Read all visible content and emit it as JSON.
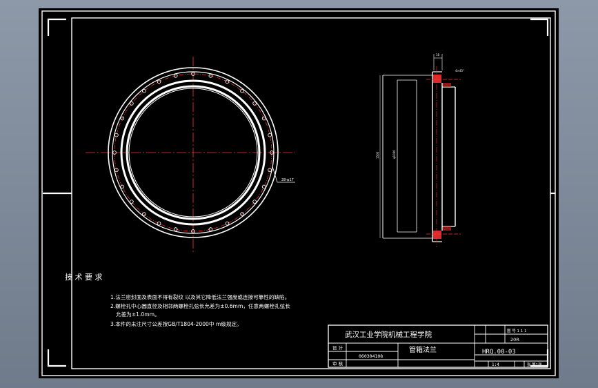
{
  "drawing": {
    "tech_req": {
      "title": "技 术 要 求",
      "items": [
        "1.法兰密封面及表面不得有裂纹 以及其它降低法兰强度或连接可靠性的缺陷。",
        "2.螺栓孔中心圆直径及相邻两螺栓孔弦长允差为±0.6mm，任意两螺栓孔弦长",
        "允差为±1.0mm。",
        "3.本件的未注尺寸公差按GB/T1804-2000中 m级规定。"
      ]
    },
    "labels": {
      "hole_callout": "28-φ17",
      "side_top_dim": "18",
      "side_angle_dim": "4×45°",
      "side_height_dim": "1500",
      "side_inner_dim": "φ1000"
    },
    "title_block": {
      "school": "武汉工业学院机械工程学院",
      "part_name": "管箱法兰",
      "drawing_no": "HRQ.00-03",
      "scale": "1:4",
      "sheet": "张 第1张",
      "designer_label": "设 计",
      "reviewer_label": "审 核",
      "student_id": "060304108",
      "material": "20R",
      "top_right": "图 号 1 1 1"
    }
  }
}
